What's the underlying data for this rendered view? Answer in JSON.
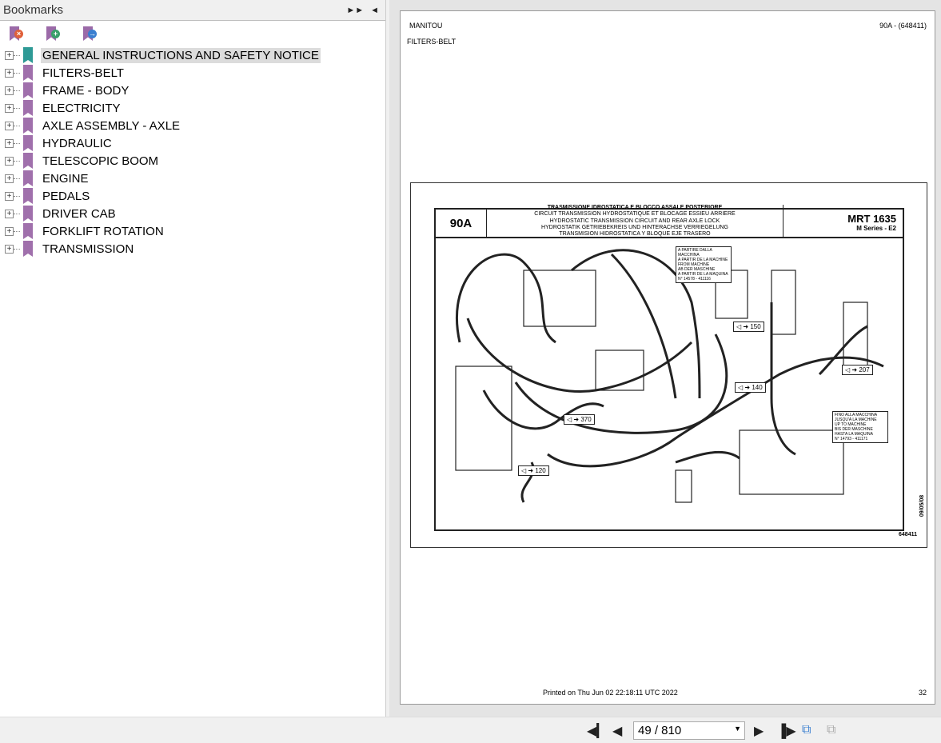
{
  "sidebar": {
    "title": "Bookmarks",
    "expand_icon": "double-arrow-right",
    "collapse_icon": "arrow-left",
    "tools": [
      {
        "name": "remove-bookmark",
        "color": "#e0603a",
        "glyph": "×"
      },
      {
        "name": "add-bookmark",
        "color": "#3aa06a",
        "glyph": "+"
      },
      {
        "name": "goto-bookmark",
        "color": "#3a7fd0",
        "glyph": "→"
      }
    ],
    "items": [
      {
        "label": "GENERAL INSTRUCTIONS AND SAFETY NOTICE",
        "selected": true
      },
      {
        "label": "FILTERS-BELT"
      },
      {
        "label": "FRAME - BODY"
      },
      {
        "label": "ELECTRICITY"
      },
      {
        "label": "AXLE ASSEMBLY - AXLE"
      },
      {
        "label": "HYDRAULIC"
      },
      {
        "label": "TELESCOPIC BOOM"
      },
      {
        "label": "ENGINE"
      },
      {
        "label": "PEDALS"
      },
      {
        "label": "DRIVER CAB"
      },
      {
        "label": "FORKLIFT ROTATION"
      },
      {
        "label": "TRANSMISSION"
      }
    ]
  },
  "page": {
    "brand": "MANITOU",
    "section": "FILTERS-BELT",
    "ref": "90A - (648411)",
    "printed": "Printed on  Thu Jun 02 22:18:11 UTC 2022",
    "number": "32",
    "sheet": {
      "code": "90A",
      "titles": [
        "TRASMISSIONE IDROSTATICA E BLOCCO ASSALE POSTERIORE",
        "CIRCUIT TRANSMISSION HYDROSTATIQUE ET BLOCAGE ESSIEU ARRIERE",
        "HYDROSTATIC TRANSMISSION CIRCUIT AND REAR AXLE LOCK",
        "HYDROSTATIK GETRIEBEKREIS UND HINTERACHSE VERRIEGELUNG",
        "TRANSMISION HIDROSTATICA Y BLOQUE EJE TRASERO"
      ],
      "model": "MRT 1635",
      "series": "M Series - E2",
      "drawing_no": "648411",
      "date": "09/05/08",
      "notice_from": [
        "A PARTIRE DALLA MACCHINA",
        "A PARTIR DE LA MACHINE",
        "FROM MACHINE",
        "AB DER MASCHINE",
        "A PARTIR DE LA MAQUINA",
        "N° 14578 - 411116"
      ],
      "notice_to": [
        "FINO ALLA MACCHINA",
        "JUSQU'A LA MACHINE",
        "UP TO MACHINE",
        "BIS DER MASCHINE",
        "HASTA LA MAQUINA",
        "N° 14793 - 411171"
      ],
      "refs": [
        "150",
        "207",
        "140",
        "370",
        "120"
      ]
    }
  },
  "navigation": {
    "page_display": "49 / 810"
  }
}
